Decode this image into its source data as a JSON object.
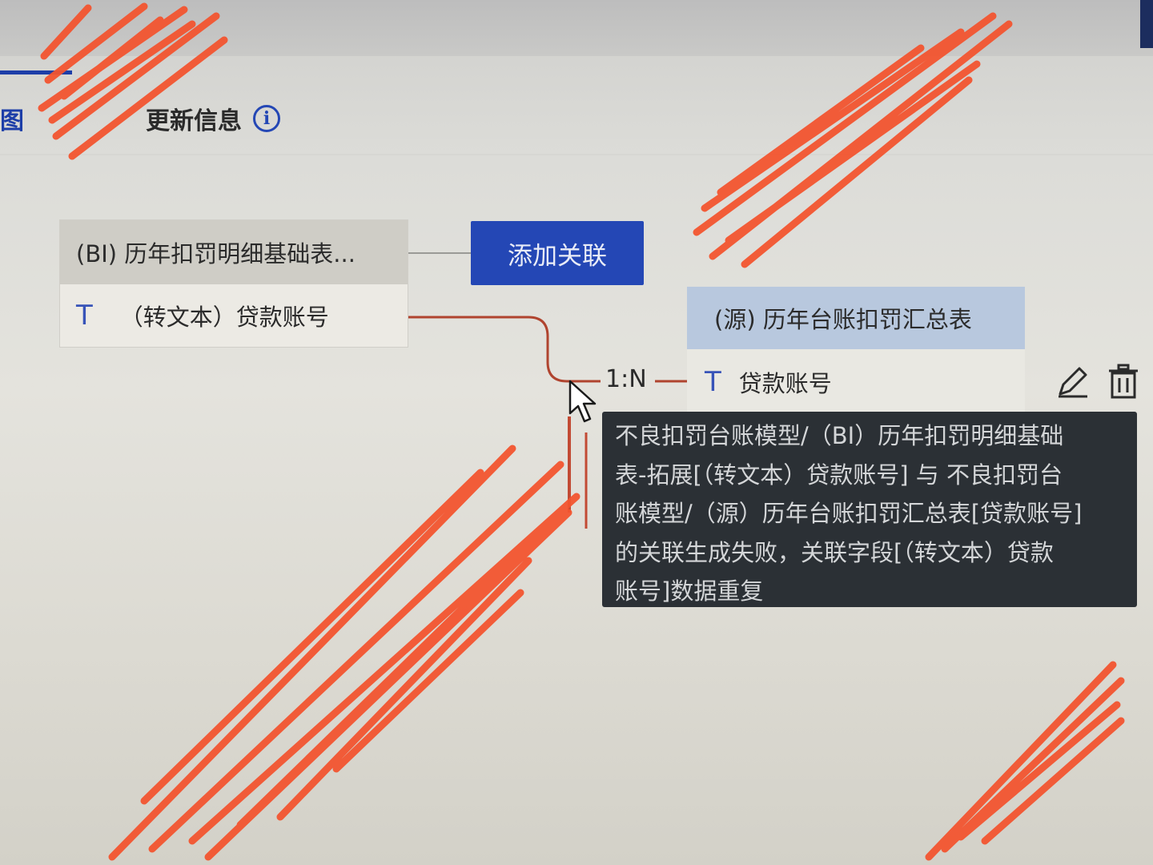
{
  "tabs": {
    "partial_left_label": "视图",
    "update_label": "更新信息",
    "info_icon": "i"
  },
  "left_table": {
    "title": "(BI) 历年扣罚明细基础表...",
    "field": {
      "type_icon": "T",
      "label": "（转文本）贷款账号"
    }
  },
  "add_relation_button": "添加关联",
  "right_table": {
    "title": "(源) 历年台账扣罚汇总表",
    "field": {
      "type_icon": "T",
      "label": "贷款账号"
    }
  },
  "relation": {
    "cardinality": "1:N",
    "edit_icon": "edit-icon",
    "delete_icon": "delete-icon"
  },
  "tooltip": {
    "lines": [
      "不良扣罚台账模型/（BI）历年扣罚明细基础",
      "表-拓展[（转文本）贷款账号] 与 不良扣罚台",
      "账模型/（源）历年台账扣罚汇总表[贷款账号]",
      "的关联生成失败，关联字段[（转文本）贷款",
      "账号]数据重复"
    ]
  },
  "colors": {
    "accent": "#2447b5",
    "link_line": "#b0442f",
    "tooltip_bg": "#2b3035",
    "scribble": "#f2542f"
  }
}
